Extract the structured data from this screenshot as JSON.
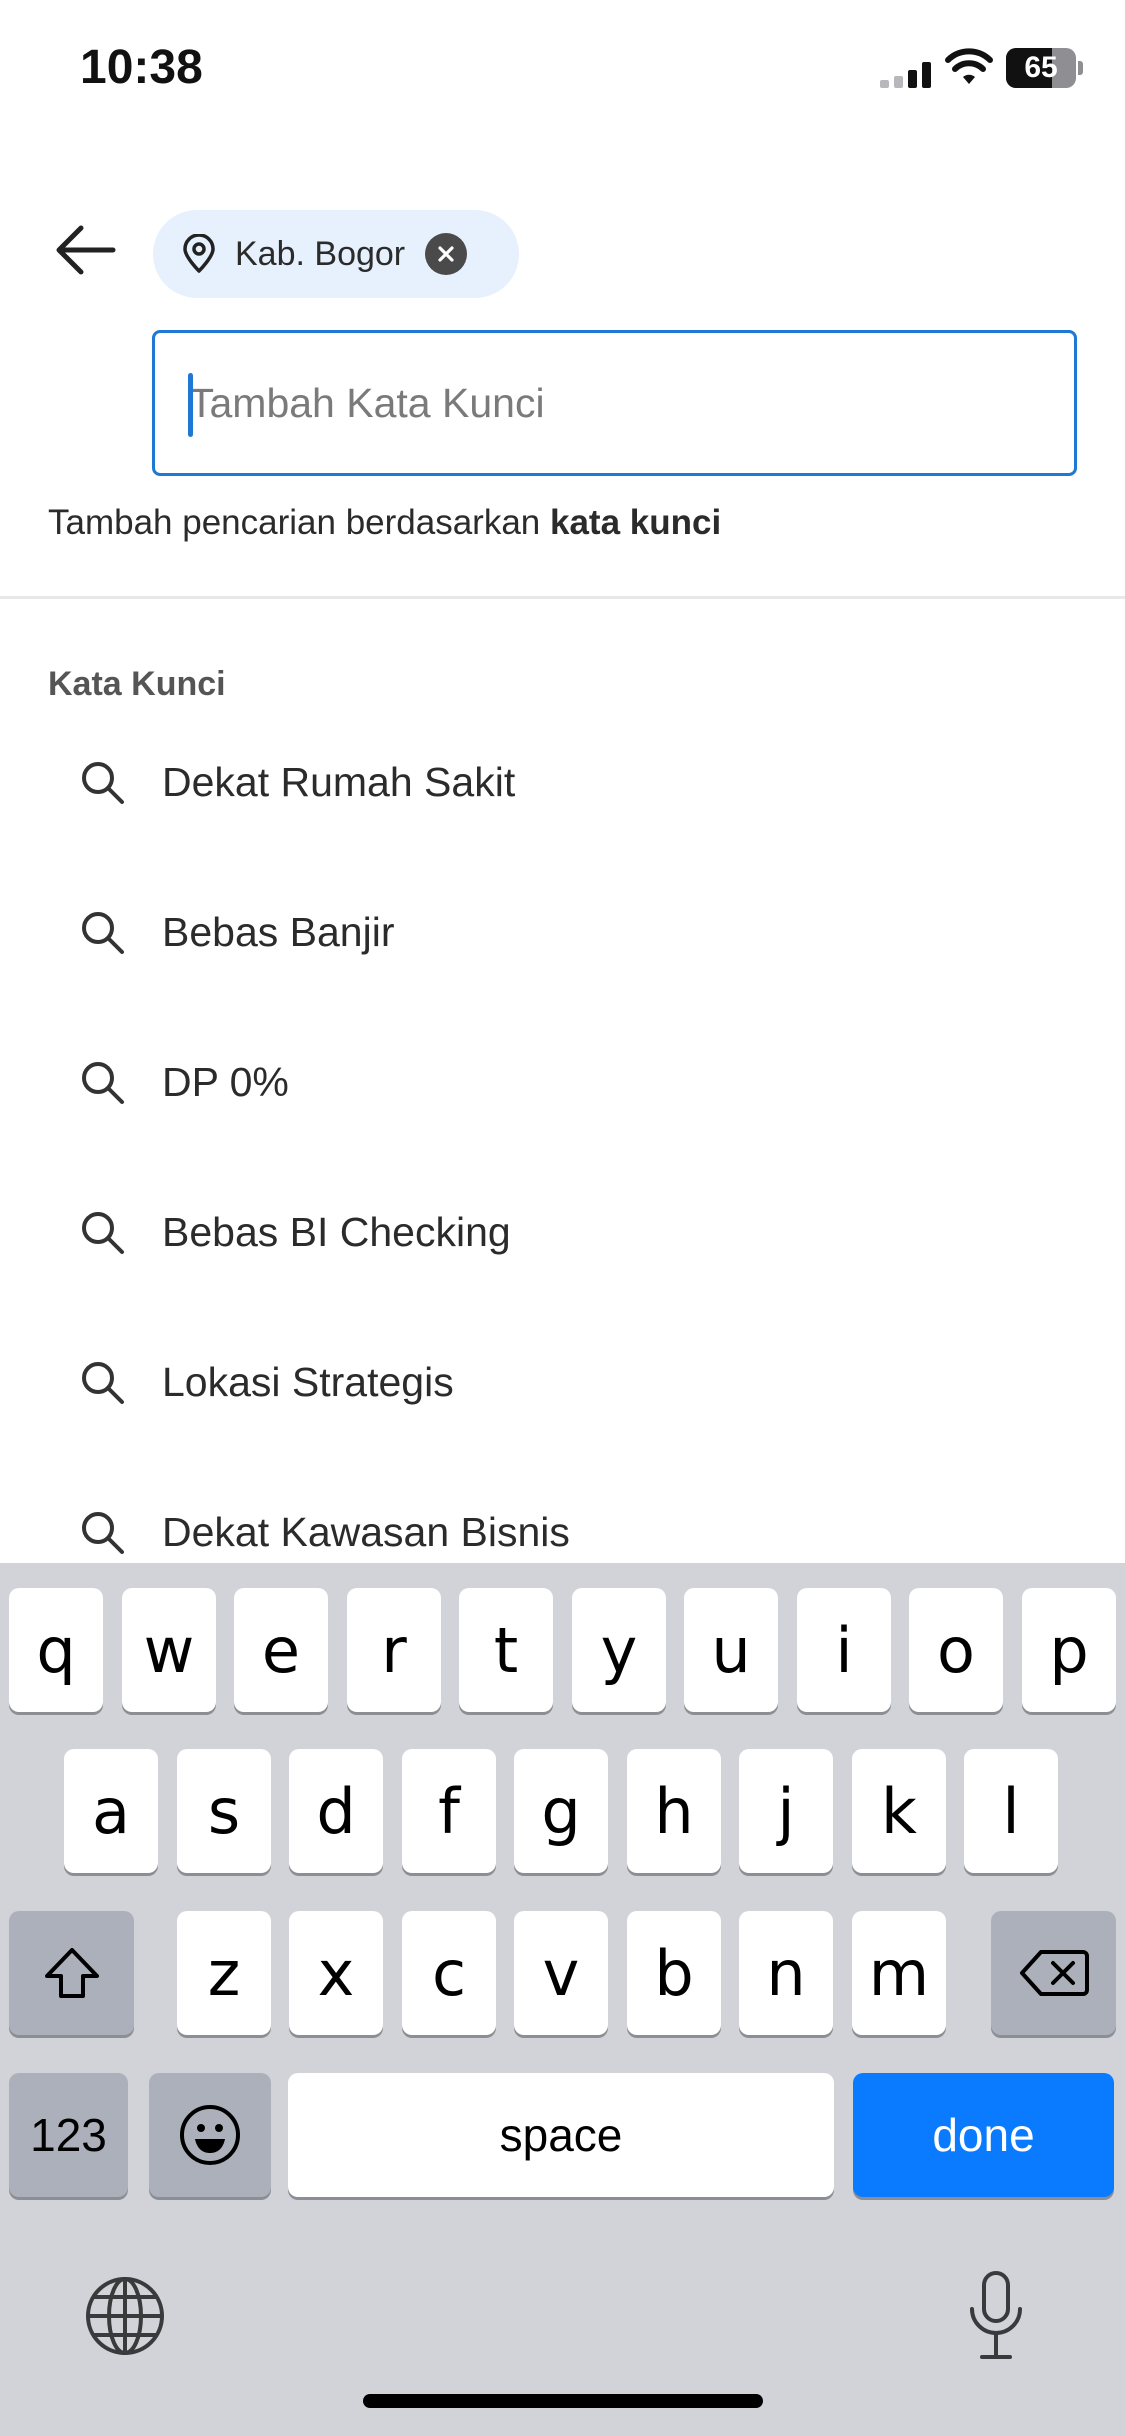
{
  "status_bar": {
    "time": "10:38",
    "battery_percent": "65",
    "battery_level": 0.65
  },
  "header": {
    "location_chip": {
      "label": "Kab. Bogor",
      "icon": "location-pin-icon",
      "remove_icon": "close-circle-icon"
    },
    "back_icon": "arrow-left-icon"
  },
  "search": {
    "placeholder": "Tambah Kata Kunci",
    "value": "",
    "hint_prefix": "Tambah pencarian berdasarkan ",
    "hint_bold": "kata kunci"
  },
  "keywords": {
    "title": "Kata Kunci",
    "items": [
      {
        "label": "Dekat Rumah Sakit",
        "icon": "search-icon"
      },
      {
        "label": "Bebas Banjir",
        "icon": "search-icon"
      },
      {
        "label": "DP 0%",
        "icon": "search-icon"
      },
      {
        "label": "Bebas BI Checking",
        "icon": "search-icon"
      },
      {
        "label": "Lokasi Strategis",
        "icon": "search-icon"
      },
      {
        "label": "Dekat Kawasan Bisnis",
        "icon": "search-icon"
      }
    ]
  },
  "keyboard": {
    "row1": [
      "q",
      "w",
      "e",
      "r",
      "t",
      "y",
      "u",
      "i",
      "o",
      "p"
    ],
    "row2": [
      "a",
      "s",
      "d",
      "f",
      "g",
      "h",
      "j",
      "k",
      "l"
    ],
    "row3": [
      "z",
      "x",
      "c",
      "v",
      "b",
      "n",
      "m"
    ],
    "numbers_label": "123",
    "space_label": "space",
    "done_label": "done",
    "accent_color": "#0a7aff"
  },
  "colors": {
    "accent": "#1f78d1",
    "chip_background": "#e6f1fd"
  }
}
